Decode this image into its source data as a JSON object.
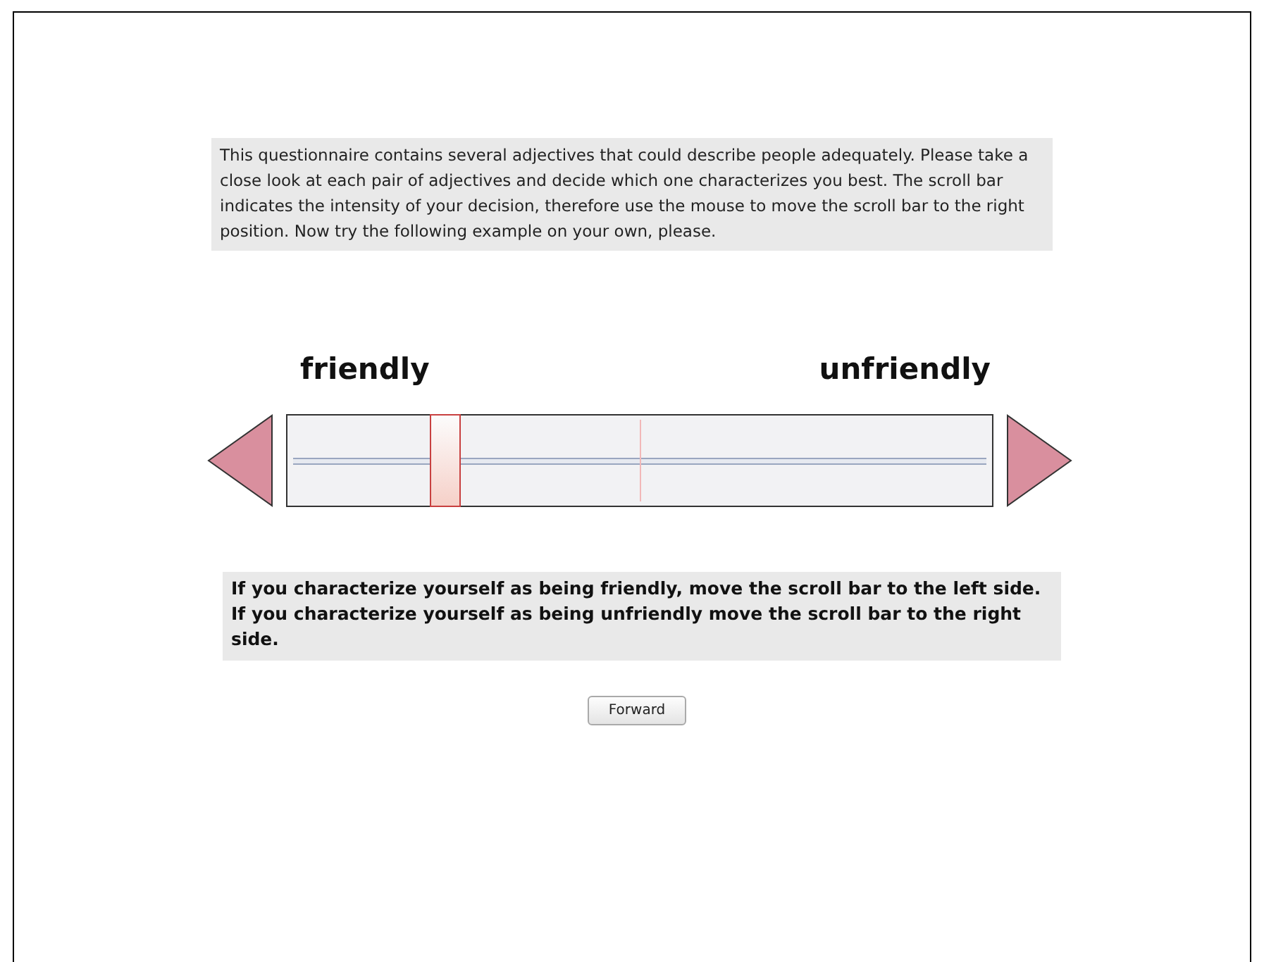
{
  "intro": "This questionnaire contains several adjectives that could describe people adequately. Please take a close look at each pair of adjectives and decide which one characterizes you best. The scroll bar indicates the intensity of your decision, therefore use the mouse to move the scroll bar to the right position. Now try the following example on your own, please.",
  "scale": {
    "left_label": "friendly",
    "right_label": "unfriendly",
    "level": 0.21
  },
  "instruction": "If you characterize yourself as being friendly, move the scroll bar to the left side. If you characterize yourself as being unfriendly move the scroll bar to the right side.",
  "buttons": [
    "Forward"
  ]
}
